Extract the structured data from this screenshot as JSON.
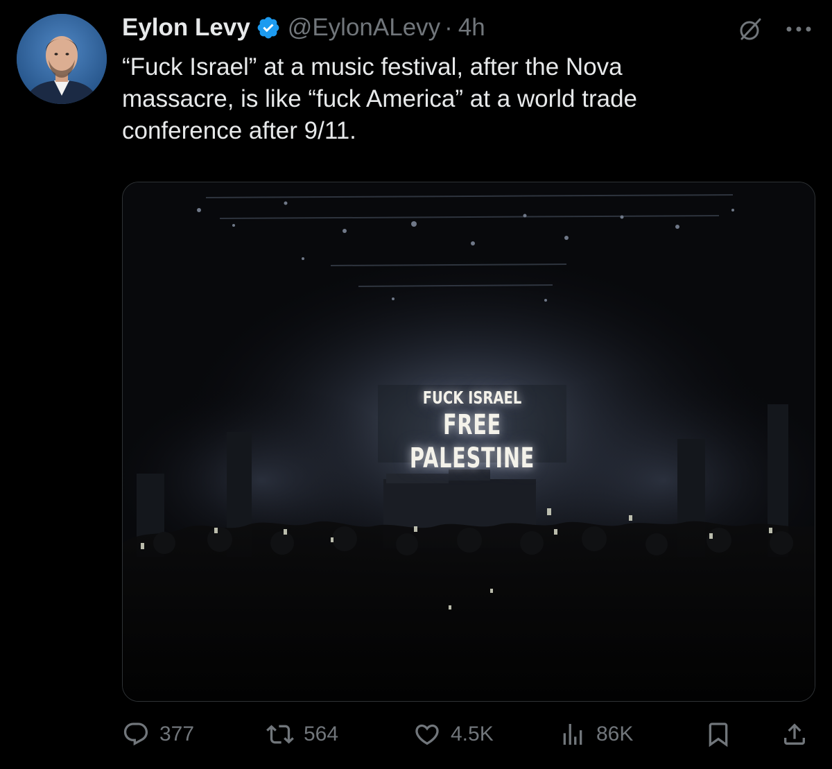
{
  "tweet": {
    "display_name": "Eylon Levy",
    "handle": "@EylonALevy",
    "separator": "·",
    "time": "4h",
    "text": "“Fuck Israel” at a music festival, after the Nova\nmassacre, is like “fuck America” at a world trade\nconference after 9/11.",
    "media": {
      "screen_line_1": "FUCK ISRAEL",
      "screen_line_2": "FREE PALESTINE"
    },
    "stats": {
      "replies": "377",
      "reposts": "564",
      "likes": "4.5K",
      "views": "86K"
    }
  },
  "icons": {
    "verified": "verified-badge-icon",
    "grok": "grok-icon",
    "more": "more-icon",
    "reply": "reply-icon",
    "repost": "repost-icon",
    "like": "heart-icon",
    "views": "views-icon",
    "bookmark": "bookmark-icon",
    "share": "share-icon"
  },
  "colors": {
    "background": "#000000",
    "primary_text": "#e7e9ea",
    "secondary_text": "#71767b",
    "verified_blue": "#1d9bf0",
    "border": "#2f3336"
  }
}
